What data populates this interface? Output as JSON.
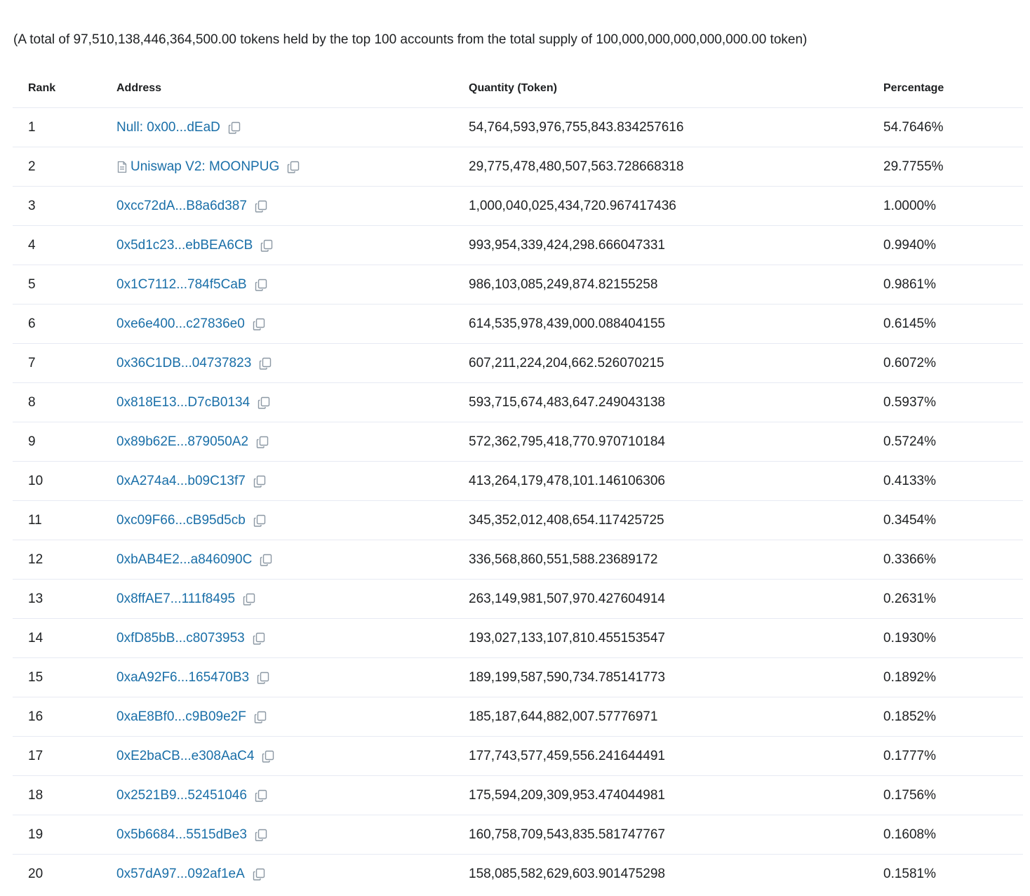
{
  "summary": {
    "text": "(A total of 97,510,138,446,364,500.00 tokens held by the top 100 accounts from the total supply of 100,000,000,000,000,000.00 token)"
  },
  "table": {
    "headers": {
      "rank": "Rank",
      "address": "Address",
      "quantity": "Quantity (Token)",
      "percentage": "Percentage"
    },
    "rows": [
      {
        "rank": "1",
        "address": "Null: 0x00...dEaD",
        "contract": false,
        "quantity": "54,764,593,976,755,843.834257616",
        "percentage": "54.7646%"
      },
      {
        "rank": "2",
        "address": "Uniswap V2: MOONPUG",
        "contract": true,
        "quantity": "29,775,478,480,507,563.728668318",
        "percentage": "29.7755%"
      },
      {
        "rank": "3",
        "address": "0xcc72dA...B8a6d387",
        "contract": false,
        "quantity": "1,000,040,025,434,720.967417436",
        "percentage": "1.0000%"
      },
      {
        "rank": "4",
        "address": "0x5d1c23...ebBEA6CB",
        "contract": false,
        "quantity": "993,954,339,424,298.666047331",
        "percentage": "0.9940%"
      },
      {
        "rank": "5",
        "address": "0x1C7112...784f5CaB",
        "contract": false,
        "quantity": "986,103,085,249,874.82155258",
        "percentage": "0.9861%"
      },
      {
        "rank": "6",
        "address": "0xe6e400...c27836e0",
        "contract": false,
        "quantity": "614,535,978,439,000.088404155",
        "percentage": "0.6145%"
      },
      {
        "rank": "7",
        "address": "0x36C1DB...04737823",
        "contract": false,
        "quantity": "607,211,224,204,662.526070215",
        "percentage": "0.6072%"
      },
      {
        "rank": "8",
        "address": "0x818E13...D7cB0134",
        "contract": false,
        "quantity": "593,715,674,483,647.249043138",
        "percentage": "0.5937%"
      },
      {
        "rank": "9",
        "address": "0x89b62E...879050A2",
        "contract": false,
        "quantity": "572,362,795,418,770.970710184",
        "percentage": "0.5724%"
      },
      {
        "rank": "10",
        "address": "0xA274a4...b09C13f7",
        "contract": false,
        "quantity": "413,264,179,478,101.146106306",
        "percentage": "0.4133%"
      },
      {
        "rank": "11",
        "address": "0xc09F66...cB95d5cb",
        "contract": false,
        "quantity": "345,352,012,408,654.117425725",
        "percentage": "0.3454%"
      },
      {
        "rank": "12",
        "address": "0xbAB4E2...a846090C",
        "contract": false,
        "quantity": "336,568,860,551,588.23689172",
        "percentage": "0.3366%"
      },
      {
        "rank": "13",
        "address": "0x8ffAE7...111f8495",
        "contract": false,
        "quantity": "263,149,981,507,970.427604914",
        "percentage": "0.2631%"
      },
      {
        "rank": "14",
        "address": "0xfD85bB...c8073953",
        "contract": false,
        "quantity": "193,027,133,107,810.455153547",
        "percentage": "0.1930%"
      },
      {
        "rank": "15",
        "address": "0xaA92F6...165470B3",
        "contract": false,
        "quantity": "189,199,587,590,734.785141773",
        "percentage": "0.1892%"
      },
      {
        "rank": "16",
        "address": "0xaE8Bf0...c9B09e2F",
        "contract": false,
        "quantity": "185,187,644,882,007.57776971",
        "percentage": "0.1852%"
      },
      {
        "rank": "17",
        "address": "0xE2baCB...e308AaC4",
        "contract": false,
        "quantity": "177,743,577,459,556.241644491",
        "percentage": "0.1777%"
      },
      {
        "rank": "18",
        "address": "0x2521B9...52451046",
        "contract": false,
        "quantity": "175,594,209,309,953.474044981",
        "percentage": "0.1756%"
      },
      {
        "rank": "19",
        "address": "0x5b6684...5515dBe3",
        "contract": false,
        "quantity": "160,758,709,543,835.581747767",
        "percentage": "0.1608%"
      },
      {
        "rank": "20",
        "address": "0x57dA97...092af1eA",
        "contract": false,
        "quantity": "158,085,582,629,603.901475298",
        "percentage": "0.1581%"
      }
    ]
  },
  "icons": {
    "copy": "copy-icon",
    "contract": "contract-file-icon"
  },
  "colors": {
    "link": "#1a6fa8",
    "text": "#1e2022",
    "border": "#e7eaf3",
    "icon": "#8c98a4"
  }
}
